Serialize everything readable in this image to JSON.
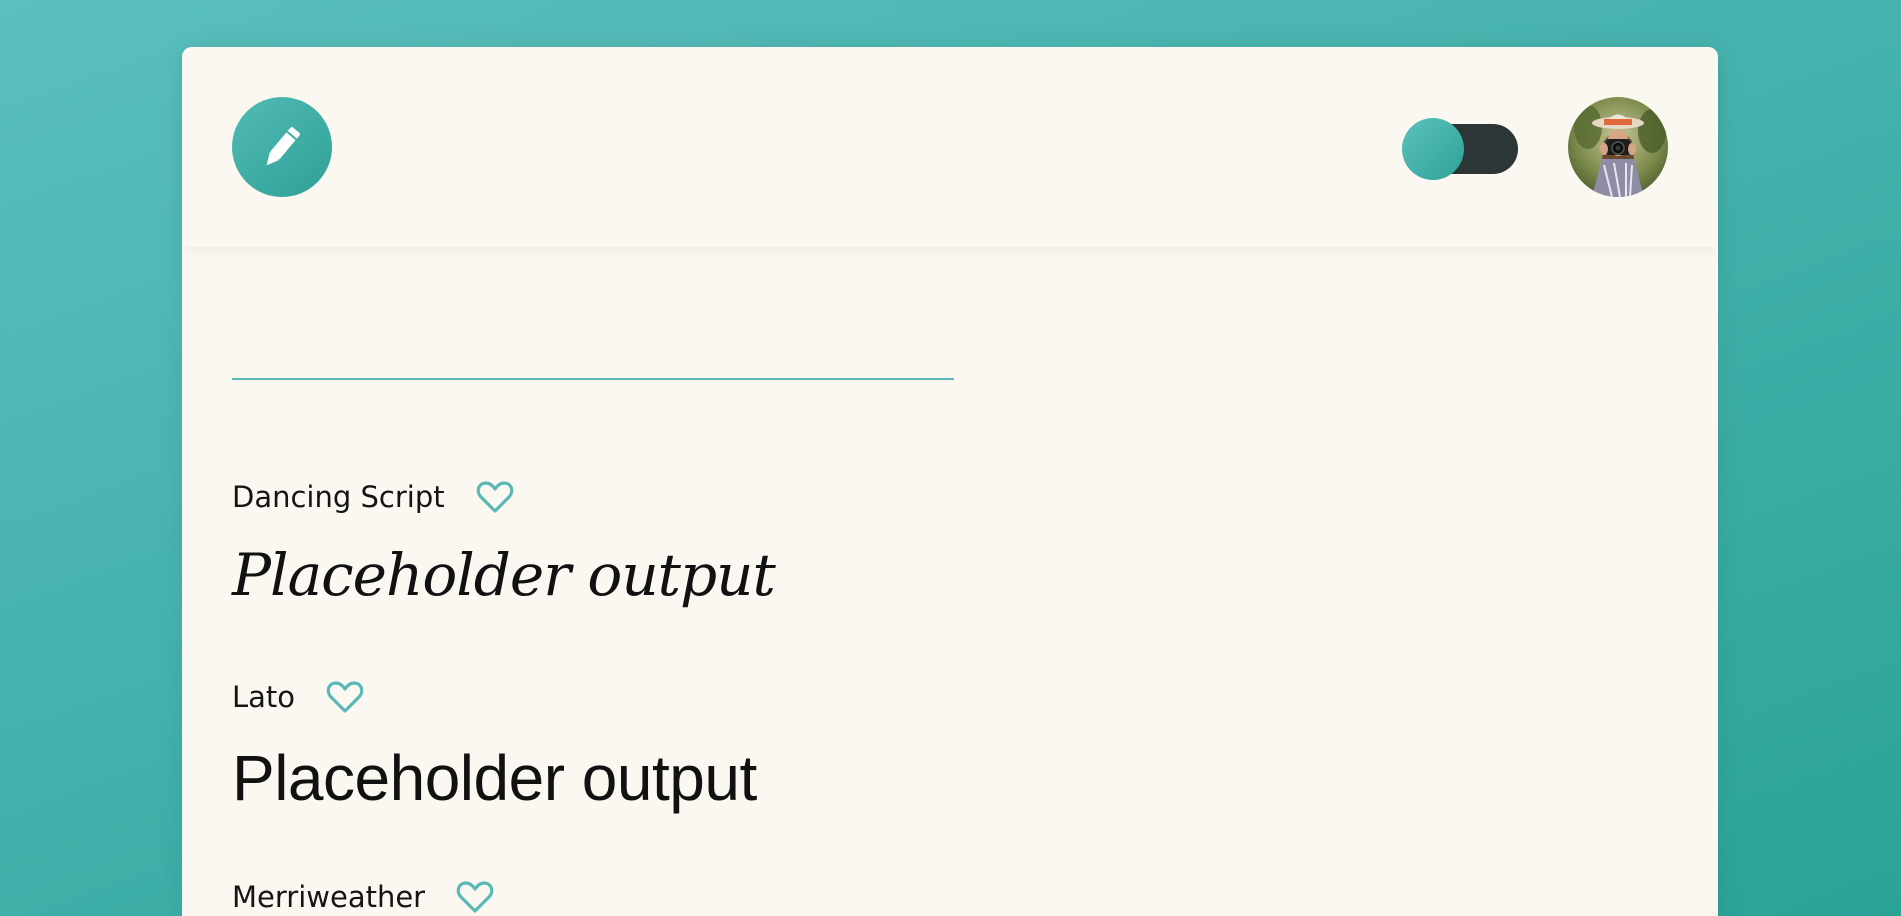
{
  "header": {
    "logo_icon": "pencil-icon",
    "theme_toggle": {
      "state": "on",
      "icon": "toggle-switch"
    },
    "avatar": {
      "icon": "user-avatar-photo"
    }
  },
  "search": {
    "value": "",
    "placeholder": ""
  },
  "fonts": [
    {
      "name": "Dancing Script",
      "sample": "Placeholder output",
      "favorite_icon": "heart-outline-icon"
    },
    {
      "name": "Lato",
      "sample": "Placeholder output",
      "favorite_icon": "heart-outline-icon"
    },
    {
      "name": "Merriweather",
      "sample": "",
      "favorite_icon": "heart-outline-icon"
    }
  ],
  "colors": {
    "accent": "#45b2ad",
    "card_background": "#fbf8f1",
    "toggle_track": "#2c3636",
    "text": "#151515"
  }
}
